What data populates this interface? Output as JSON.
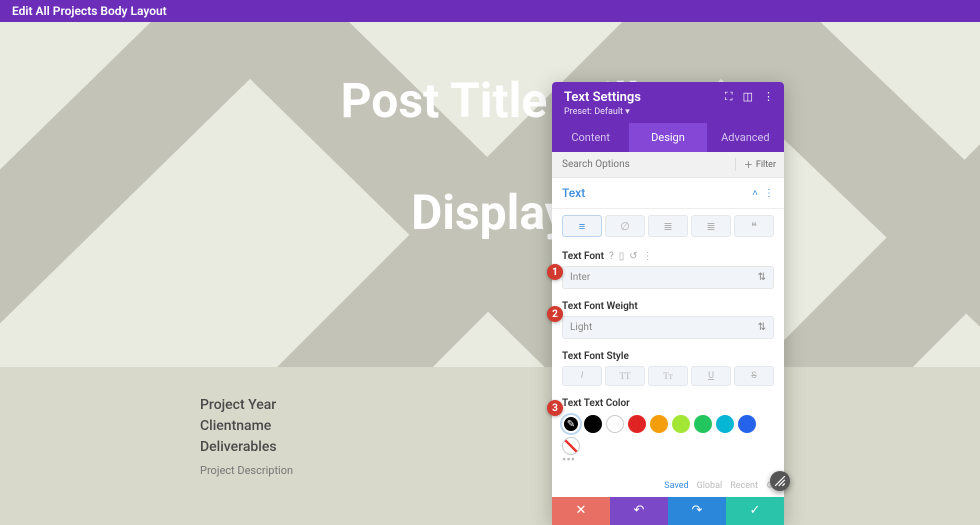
{
  "topbar": {
    "title": "Edit All Projects Body Layout"
  },
  "hero": {
    "line1": "Post Title Will",
    "line2": "Display"
  },
  "content": {
    "year": "Project Year",
    "client": "Clientname",
    "deliverables": "Deliverables",
    "desc": "Project Description"
  },
  "panel": {
    "title": "Text Settings",
    "preset": "Preset: Default ▾",
    "tabs": {
      "content": "Content",
      "design": "Design",
      "advanced": "Advanced"
    },
    "search_placeholder": "Search Options",
    "filter": "Filter",
    "section": "Text",
    "font_label": "Text Font",
    "font_value": "Inter",
    "weight_label": "Text Font Weight",
    "weight_value": "Light",
    "style_label": "Text Font Style",
    "color_label": "Text Text Color",
    "swatches": {
      "black": "#000000",
      "red": "#e02424",
      "orange": "#f59e0b",
      "lime": "#a3e635",
      "green": "#22c55e",
      "cyan": "#06b6d4",
      "blue": "#2563eb",
      "purple": "#7c3aed"
    },
    "meta": {
      "saved": "Saved",
      "global": "Global",
      "recent": "Recent"
    }
  },
  "badges": {
    "b1": "1",
    "b2": "2",
    "b3": "3"
  }
}
